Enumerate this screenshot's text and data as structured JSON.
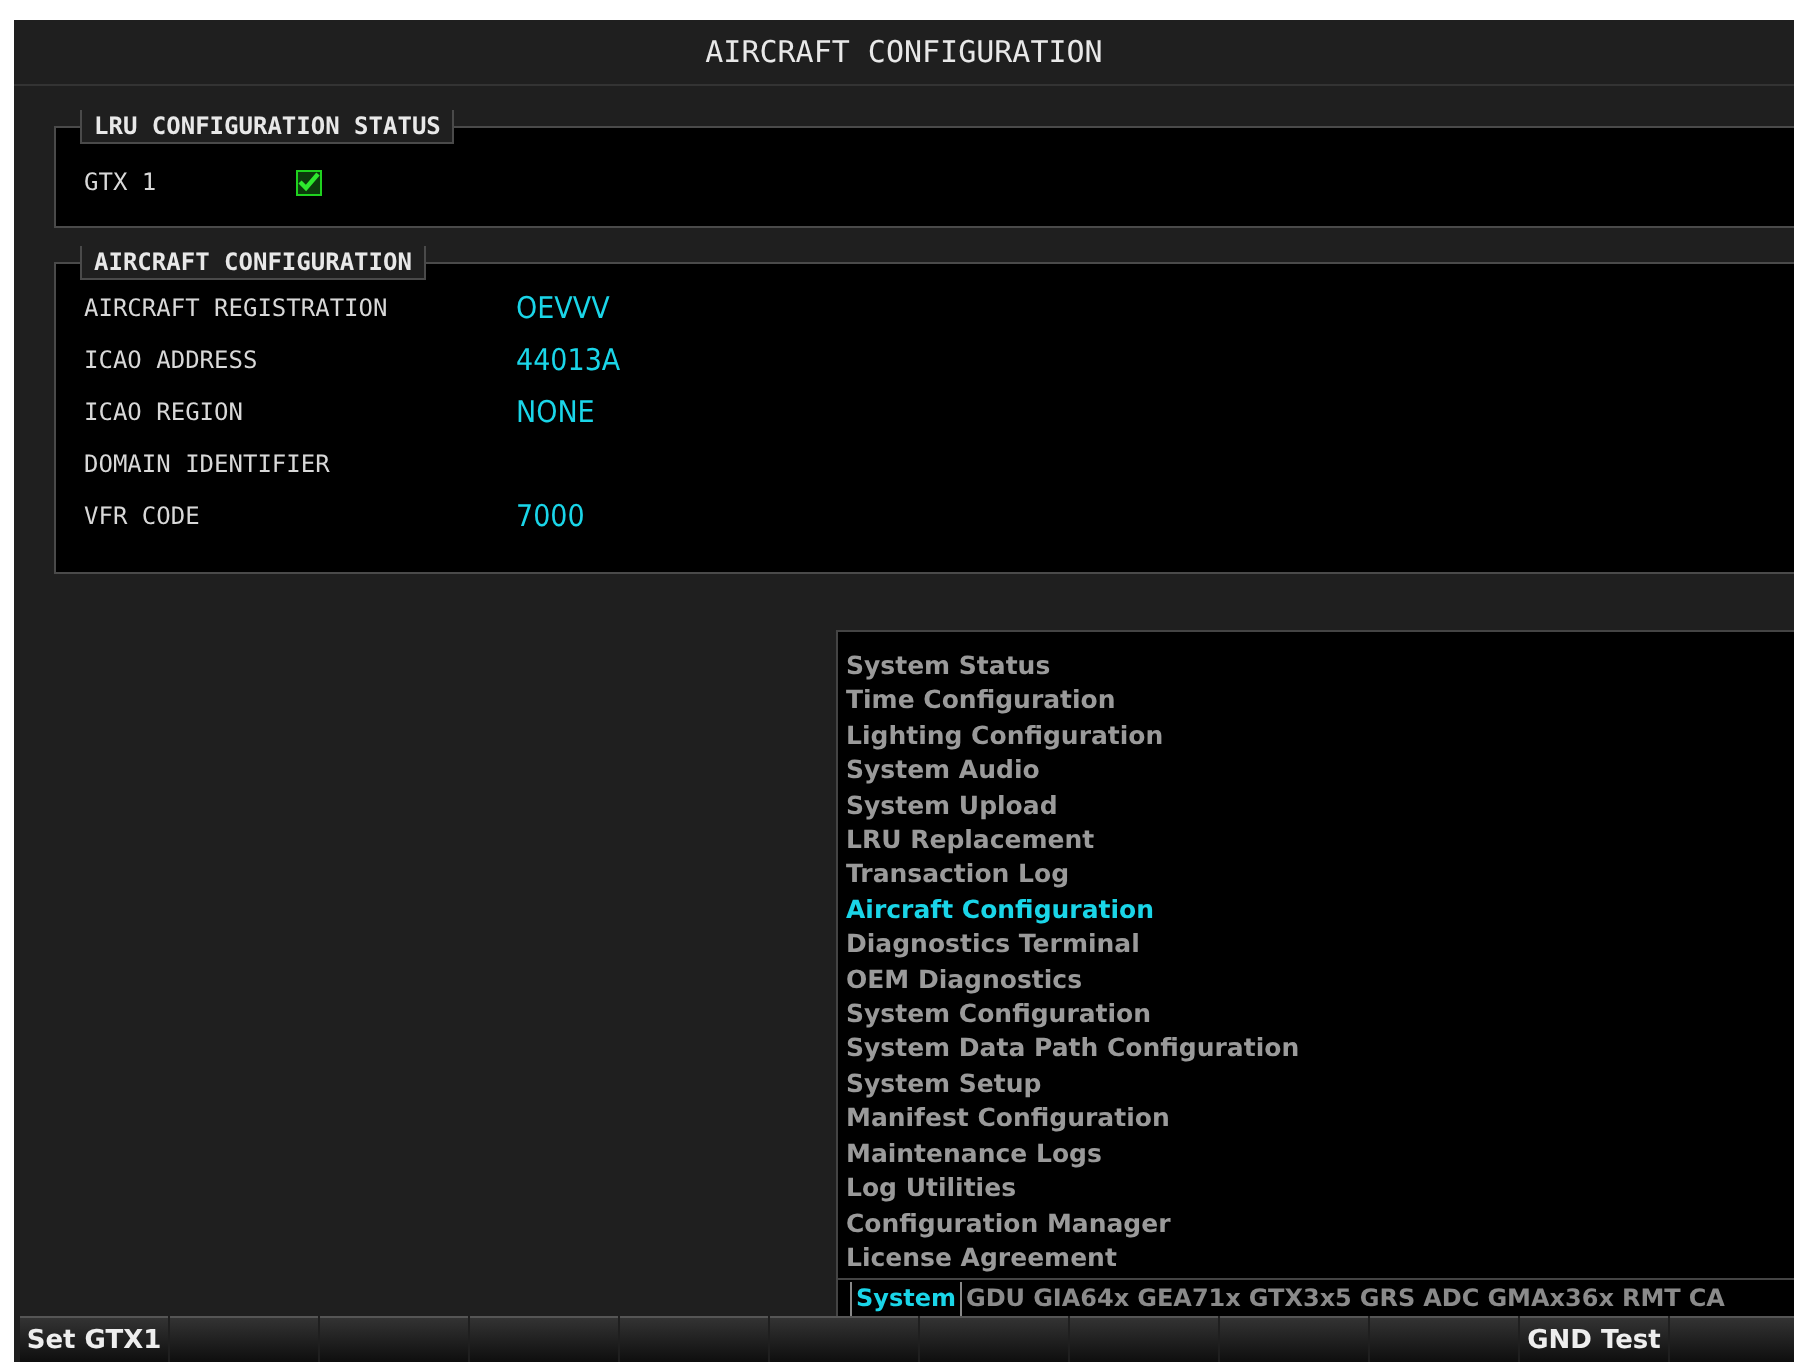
{
  "title": "AIRCRAFT CONFIGURATION",
  "lru_status": {
    "legend": "LRU CONFIGURATION STATUS",
    "items": [
      {
        "label": "GTX 1",
        "checked": true
      }
    ]
  },
  "aircraft_configuration": {
    "legend": "AIRCRAFT CONFIGURATION",
    "fields": [
      {
        "label": "AIRCRAFT REGISTRATION",
        "value": "OEVVV"
      },
      {
        "label": "ICAO ADDRESS",
        "value": "44013A"
      },
      {
        "label": "ICAO REGION",
        "value": "NONE"
      },
      {
        "label": "DOMAIN IDENTIFIER"
      },
      {
        "label": "VFR CODE",
        "value": "7000"
      }
    ]
  },
  "menu": {
    "items": [
      {
        "label": "System Status",
        "selected": false
      },
      {
        "label": "Time Configuration",
        "selected": false
      },
      {
        "label": "Lighting Configuration",
        "selected": false
      },
      {
        "label": "System Audio",
        "selected": false
      },
      {
        "label": "System Upload",
        "selected": false
      },
      {
        "label": "LRU Replacement",
        "selected": false
      },
      {
        "label": "Transaction Log",
        "selected": false
      },
      {
        "label": "Aircraft Configuration",
        "selected": true
      },
      {
        "label": "Diagnostics Terminal",
        "selected": false
      },
      {
        "label": "OEM Diagnostics",
        "selected": false
      },
      {
        "label": "System Configuration",
        "selected": false
      },
      {
        "label": "System Data Path Configuration",
        "selected": false
      },
      {
        "label": "System Setup",
        "selected": false
      },
      {
        "label": "Manifest Configuration",
        "selected": false
      },
      {
        "label": "Maintenance Logs",
        "selected": false
      },
      {
        "label": "Log Utilities",
        "selected": false
      },
      {
        "label": "Configuration Manager",
        "selected": false
      },
      {
        "label": "License Agreement",
        "selected": false
      }
    ],
    "tabs": [
      {
        "label": "System",
        "selected": true
      },
      {
        "label": "GDU",
        "selected": false
      },
      {
        "label": "GIA64x",
        "selected": false
      },
      {
        "label": "GEA71x",
        "selected": false
      },
      {
        "label": "GTX3x5",
        "selected": false
      },
      {
        "label": "GRS",
        "selected": false
      },
      {
        "label": "ADC",
        "selected": false
      },
      {
        "label": "GMAx36x",
        "selected": false
      },
      {
        "label": "RMT",
        "selected": false
      },
      {
        "label": "CA",
        "selected": false
      }
    ]
  },
  "softkeys": [
    {
      "label": "Set GTX1"
    },
    {
      "label": "GND Test"
    }
  ]
}
